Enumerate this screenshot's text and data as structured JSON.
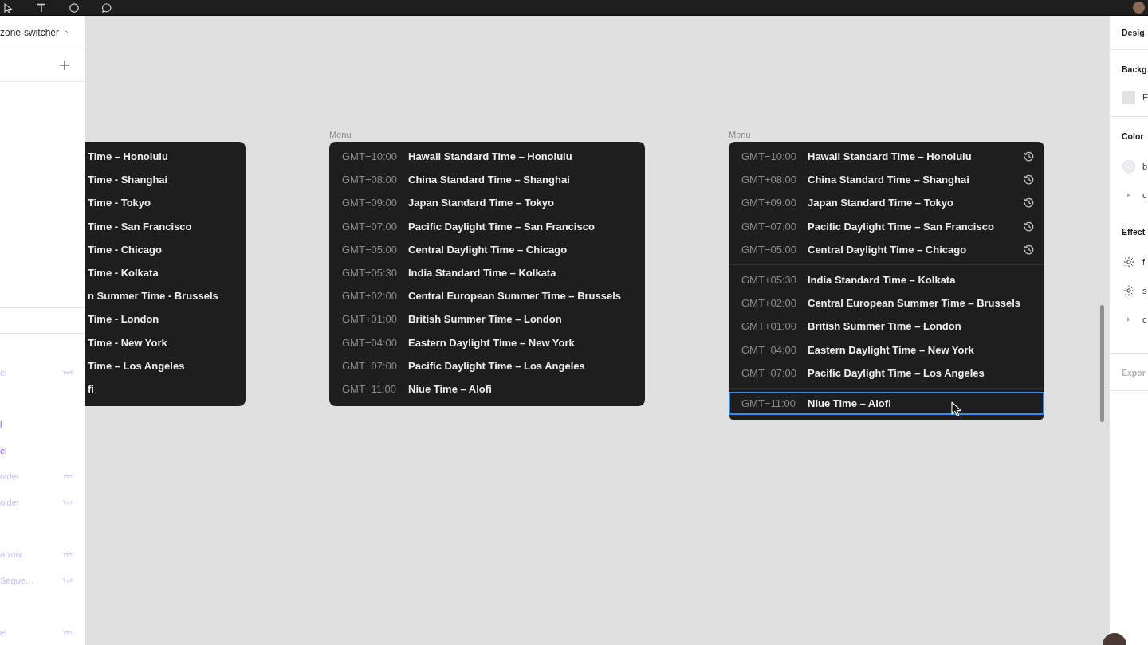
{
  "sidebar": {
    "file_name": "zone-switcher",
    "layers": [
      {
        "children": [
          {
            "name": "el",
            "hidden": true
          }
        ]
      },
      {
        "children": [
          {
            "name": "l",
            "hidden": false
          },
          {
            "name": "el",
            "hidden": false
          },
          {
            "name": "older",
            "hidden": true
          },
          {
            "name": "older",
            "hidden": true
          }
        ]
      },
      {
        "children": [
          {
            "name": "arrow",
            "hidden": true
          },
          {
            "name": "Seque…",
            "hidden": true
          }
        ]
      },
      {
        "children": [
          {
            "name": "el",
            "hidden": true
          }
        ]
      }
    ]
  },
  "canvas": {
    "frames": [
      {
        "kind": "clipped",
        "sections": [
          {
            "items": [
              {
                "name": "Time – Honolulu"
              },
              {
                "name": "Time - Shanghai"
              },
              {
                "name": "Time - Tokyo"
              },
              {
                "name": "Time - San Francisco"
              },
              {
                "name": "Time - Chicago"
              },
              {
                "name": "Time - Kolkata"
              },
              {
                "name": "n Summer Time - Brussels"
              },
              {
                "name": "Time - London"
              },
              {
                "name": "Time - New York"
              },
              {
                "name": "Time – Los Angeles"
              },
              {
                "name": "fi"
              }
            ]
          }
        ]
      },
      {
        "kind": "menu",
        "title": "Menu",
        "sections": [
          {
            "items": [
              {
                "offset": "GMT−10:00",
                "name": "Hawaii Standard Time – Honolulu"
              },
              {
                "offset": "GMT+08:00",
                "name": "China Standard Time – Shanghai"
              },
              {
                "offset": "GMT+09:00",
                "name": "Japan Standard Time – Tokyo"
              },
              {
                "offset": "GMT−07:00",
                "name": "Pacific Daylight Time – San Francisco"
              },
              {
                "offset": "GMT−05:00",
                "name": "Central Daylight Time – Chicago"
              },
              {
                "offset": "GMT+05:30",
                "name": "India Standard Time – Kolkata"
              },
              {
                "offset": "GMT+02:00",
                "name": "Central European Summer Time – Brussels"
              },
              {
                "offset": "GMT+01:00",
                "name": "British Summer Time – London"
              },
              {
                "offset": "GMT−04:00",
                "name": "Eastern Daylight Time – New York"
              },
              {
                "offset": "GMT−07:00",
                "name": "Pacific Daylight Time – Los Angeles"
              },
              {
                "offset": "GMT−11:00",
                "name": "Niue Time – Alofi"
              }
            ]
          }
        ]
      },
      {
        "kind": "menu",
        "title": "Menu",
        "sections": [
          {
            "items": [
              {
                "offset": "GMT−10:00",
                "name": "Hawaii Standard Time – Honolulu",
                "recent": true,
                "selected": false
              },
              {
                "offset": "GMT+08:00",
                "name": "China Standard Time – Shanghai",
                "recent": true,
                "selected": false
              },
              {
                "offset": "GMT+09:00",
                "name": "Japan Standard Time – Tokyo",
                "recent": true,
                "selected": false
              },
              {
                "offset": "GMT−07:00",
                "name": "Pacific Daylight Time – San Francisco",
                "recent": true,
                "selected": false
              },
              {
                "offset": "GMT−05:00",
                "name": "Central Daylight Time – Chicago",
                "recent": true,
                "selected": false
              }
            ]
          },
          {
            "items": [
              {
                "offset": "GMT+05:30",
                "name": "India Standard Time – Kolkata",
                "recent": false,
                "selected": false
              },
              {
                "offset": "GMT+02:00",
                "name": "Central European Summer Time – Brussels",
                "recent": false,
                "selected": false
              },
              {
                "offset": "GMT+01:00",
                "name": "British Summer Time – London",
                "recent": false,
                "selected": false
              },
              {
                "offset": "GMT−04:00",
                "name": "Eastern Daylight Time – New York",
                "recent": false,
                "selected": false
              },
              {
                "offset": "GMT−07:00",
                "name": "Pacific Daylight Time – Los Angeles",
                "recent": false,
                "selected": false
              }
            ]
          },
          {
            "items": [
              {
                "offset": "GMT−11:00",
                "name": "Niue Time – Alofi",
                "recent": false,
                "selected": true
              }
            ]
          }
        ]
      }
    ]
  },
  "design_panel": {
    "tabs": [
      {
        "label": "Desig",
        "selected": true
      }
    ],
    "sections": [
      {
        "groups": [
          {
            "title": "Backg",
            "empty": false,
            "rows": [
              {
                "kind": "fill",
                "label": "E"
              }
            ]
          }
        ]
      },
      {
        "groups": [
          {
            "title": "Color",
            "empty": false,
            "rows": [
              {
                "kind": "style",
                "label": "b"
              },
              {
                "kind": "group",
                "label": "c"
              }
            ]
          },
          {
            "title": "Effect",
            "empty": false,
            "rows": [
              {
                "kind": "effect",
                "label": "f"
              },
              {
                "kind": "effect",
                "label": "s"
              },
              {
                "kind": "group",
                "label": "c"
              }
            ]
          }
        ]
      },
      {
        "groups": [
          {
            "title": "Expor",
            "empty": true
          }
        ]
      }
    ]
  }
}
